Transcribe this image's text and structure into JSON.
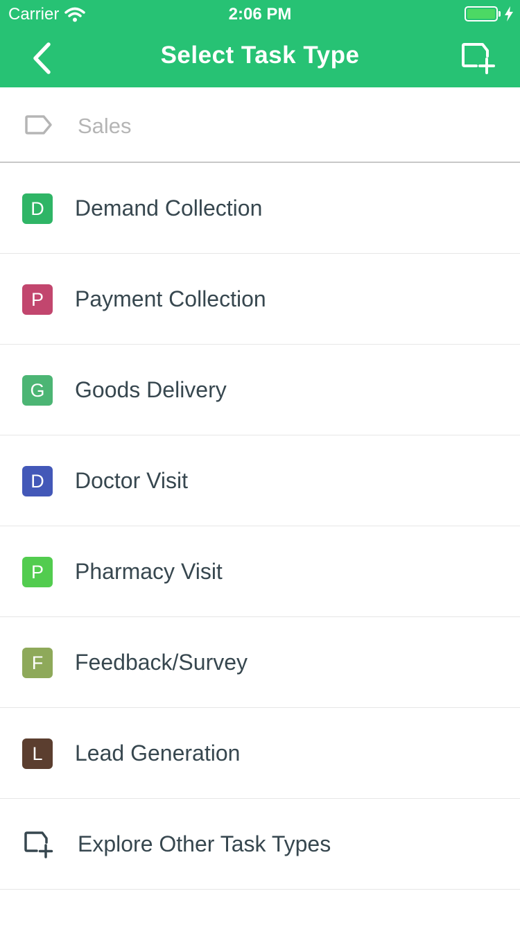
{
  "status_bar": {
    "carrier": "Carrier",
    "time": "2:06 PM"
  },
  "header": {
    "title": "Select Task Type",
    "back_icon": "chevron-left-icon",
    "add_icon": "add-task-type-icon"
  },
  "category": {
    "label": "Sales",
    "icon": "tag-icon"
  },
  "task_types": [
    {
      "initial": "D",
      "label": "Demand Collection",
      "color": "#2fb566"
    },
    {
      "initial": "P",
      "label": "Payment Collection",
      "color": "#c2466e"
    },
    {
      "initial": "G",
      "label": "Goods Delivery",
      "color": "#4cb574"
    },
    {
      "initial": "D",
      "label": "Doctor Visit",
      "color": "#4358b8"
    },
    {
      "initial": "P",
      "label": "Pharmacy Visit",
      "color": "#52cc4f"
    },
    {
      "initial": "F",
      "label": "Feedback/Survey",
      "color": "#8ea95a"
    },
    {
      "initial": "L",
      "label": "Lead Generation",
      "color": "#5b3e2f"
    }
  ],
  "explore": {
    "label": "Explore Other Task Types",
    "icon": "add-task-type-icon"
  },
  "colors": {
    "accent": "#27c274",
    "text": "#37474f",
    "muted": "#b5b5b5"
  }
}
